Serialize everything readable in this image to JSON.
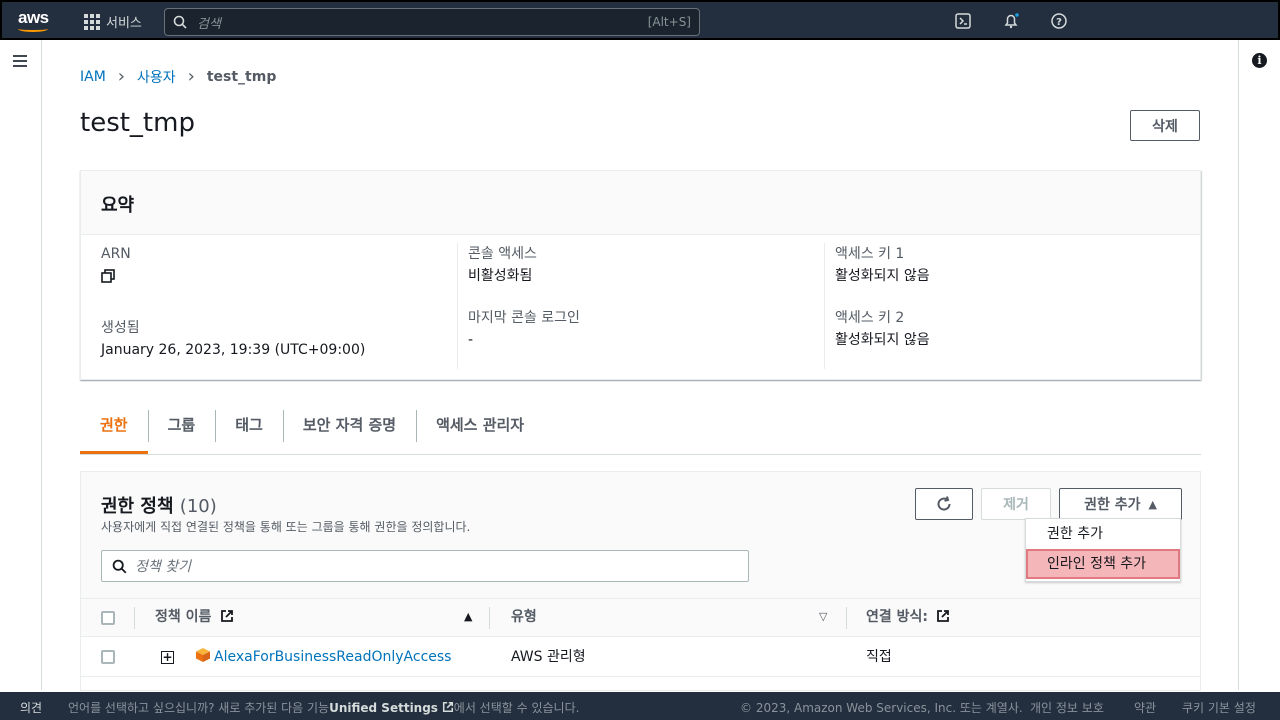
{
  "topnav": {
    "logo": "aws",
    "services_label": "서비스",
    "search_placeholder": "검색",
    "search_shortcut": "[Alt+S]"
  },
  "breadcrumb": [
    "IAM",
    "사용자",
    "test_tmp"
  ],
  "page_title": "test_tmp",
  "delete_label": "삭제",
  "summary": {
    "title": "요약",
    "arn_label": "ARN",
    "created_label": "생성됨",
    "created_value": "January 26, 2023, 19:39 (UTC+09:00)",
    "console_access_label": "콘솔 액세스",
    "console_access_value": "비활성화됨",
    "last_login_label": "마지막 콘솔 로그인",
    "last_login_value": "-",
    "key1_label": "액세스 키 1",
    "key1_value": "활성화되지 않음",
    "key2_label": "액세스 키 2",
    "key2_value": "활성화되지 않음"
  },
  "tabs": [
    "권한",
    "그룹",
    "태그",
    "보안 자격 증명",
    "액세스 관리자"
  ],
  "permissions": {
    "title": "권한 정책",
    "count": "(10)",
    "description": "사용자에게 직접 연결된 정책을 통해 또는 그룹을 통해 권한을 정의합니다.",
    "remove_label": "제거",
    "add_label": "권한 추가",
    "search_placeholder": "정책 찾기",
    "columns": {
      "name": "정책 이름",
      "type": "유형",
      "attach": "연결 방식:"
    },
    "rows": [
      {
        "name": "AlexaForBusinessReadOnlyAccess",
        "type": "AWS 관리형",
        "attach": "직접"
      }
    ],
    "dropdown": [
      "권한 추가",
      "인라인 정책 추가"
    ]
  },
  "footer": {
    "feedback": "의견",
    "language_prompt": "언어를 선택하고 싶으십니까? 새로 추가된 다음 기능",
    "unified_settings": "Unified Settings",
    "language_suffix": "에서 선택할 수 있습니다.",
    "copyright": "© 2023, Amazon Web Services, Inc. 또는 계열사.",
    "privacy": "개인 정보 보호",
    "terms": "약관",
    "cookies": "쿠키 기본 설정"
  }
}
